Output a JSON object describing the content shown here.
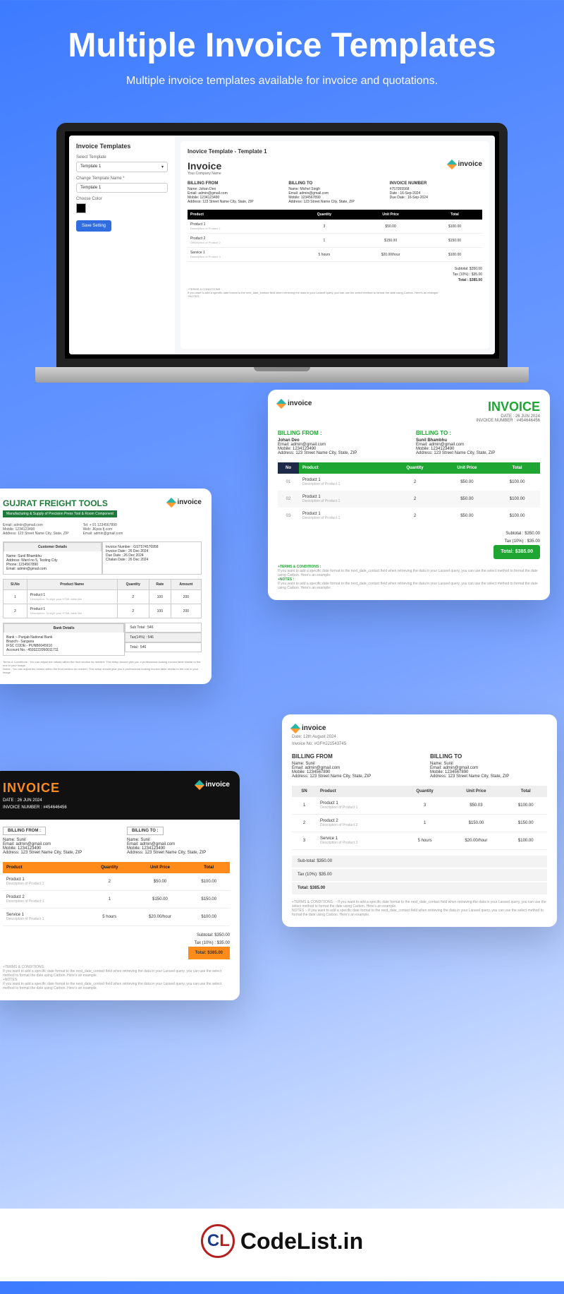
{
  "hero": {
    "title": "Multiple Invoice Templates",
    "subtitle": "Multiple invoice templates available for invoice and quotations."
  },
  "laptop": {
    "sidebar": {
      "title": "Invoice Templates",
      "select_label": "Select Template",
      "select_value": "Template 1",
      "name_label": "Change Template Name *",
      "name_value": "Template 1",
      "color_label": "Choose Color",
      "save": "Save Setting"
    },
    "preview": {
      "section_title": "Inovice Template - Template 1",
      "invoice_title": "Invoice",
      "company": "Your Company Name",
      "brand": "invoice",
      "from_h": "BILLING FROM",
      "from_lines": "Name: Johan Deo\nEmail: admin@gmail.com\nMobile: 1234123490\nAddress: 123 Street Name City, State, ZIP",
      "to_h": "BILLING TO",
      "to_lines": "Name: Michel Singh\nEmail: admin@gmail.com\nMobile: 1234567890\nAddress: 123 Street Name City, State, ZIP",
      "num_h": "INVOICE NUMBER",
      "num_lines": "#757055568\nDate : 16-Sep-2024\nDue Date : 16-Sep-2024",
      "th": {
        "p": "Product",
        "q": "Quantity",
        "u": "Unit Price",
        "t": "Total"
      },
      "rows": [
        {
          "p": "Product 1",
          "d": "Description of Product 1",
          "q": "3",
          "u": "$50.00",
          "t": "$100.00"
        },
        {
          "p": "Product 2",
          "d": "Description of Product 2",
          "q": "1",
          "u": "$150.00",
          "t": "$150.00"
        },
        {
          "p": "Service 1",
          "d": "Description of Product 3",
          "q": "5 hours",
          "u": "$20.00/hour",
          "t": "$100.00"
        }
      ],
      "subtotal": "Subtotal:  $350.00",
      "tax": "Tax (10%) :  $35.00",
      "total": "Total :  $385.00",
      "terms": "+TERMS & CONDITIONS :\nIf you want to add a specific date format to the next_date_contact field when retrieving the data in your Laravel query, you can use the select method to format the date using Carbon. Here's an example:\n+NOTES :"
    }
  },
  "card2": {
    "brand": "invoice",
    "title": "INVOICE",
    "date": "DATE : 26 JUN 2024",
    "number": "INVOICE NUMBER : #454646456",
    "from_h": "BILLING FROM :",
    "from_name": "Johan Deo",
    "to_h": "BILLING TO :",
    "to_name": "Sunil Bhambhu",
    "contact": "Email: admin@gmail.com\nMobile: 1234123490\nAddress: 123 Street Name City, State, ZIP",
    "th": {
      "n": "No",
      "p": "Product",
      "q": "Quantity",
      "u": "Unit Price",
      "t": "Total"
    },
    "rows": [
      {
        "n": "01",
        "p": "Product 1",
        "d": "Description of Product 1",
        "q": "2",
        "u": "$50.00",
        "t": "$100.00"
      },
      {
        "n": "02",
        "p": "Product 1",
        "d": "Description of Product 1",
        "q": "2",
        "u": "$50.00",
        "t": "$100.00"
      },
      {
        "n": "03",
        "p": "Product 1",
        "d": "Description of Product 1",
        "q": "2",
        "u": "$50.00",
        "t": "$100.00"
      }
    ],
    "subtotal": "Subtotal :  $350.00",
    "tax": "Tax (10%) :  $35.00",
    "total": "Total:  $385.00",
    "terms_h": "+TERMS & CONDITIONS :",
    "terms_body": "If you want to add a specific date format to the next_date_contact field when retrieving the data in your Laravel query, you can use the select method to format the date using Carbon. Here's an example:",
    "notes_h": "+NOTES :",
    "notes_body": "If you want to add a specific date format to the next_date_contact field when retrieving the data in your Laravel query, you can use the select method to format the date using Carbon. Here's an example:"
  },
  "card3": {
    "brand": "invoice",
    "name": "GUJRAT FREIGHT TOOLS",
    "bar": "Manufacturing & Supply of Precision Press Tool & Room Component",
    "left_info": "Email: admin@gmail.com\nMobile: 1234123490\nAddress: 123 Street Name City, State, ZIP",
    "right_info": "Tel: + 91 1234567890\nWeb: JKpos.fj.com\nEmail: admin@gmail.com",
    "cust_h": "Customer Details",
    "cust": "Name: Sunil Bhambhu\nAddress: Ward no 5, Testing City\nPhone: 1234567890\nEmail: admin@gmail.com",
    "inv_info": "Invoice Number : GST574576958\nInvoice Date : 26 Dec 2024\nDue Date : 26 Dec 2024\nChalan Date : 26 Dec 2024",
    "th": {
      "s": "Sl.No",
      "p": "Product Name",
      "q": "Quantity",
      "r": "Rate",
      "a": "Amount"
    },
    "rows": [
      {
        "s": "1",
        "p": "Product 1",
        "d": "Description: To style your HTML table like",
        "q": "2",
        "r": "100",
        "a": "200"
      },
      {
        "s": "2",
        "p": "Product 1",
        "d": "Description: To style your HTML table like",
        "q": "2",
        "r": "100",
        "a": "200"
      }
    ],
    "bank_h": "Bank Details",
    "bank": "Bank :- Punjab National Bank\nBranch:- Sargana\nIFSC CODE:- PUNB0045910\nAccount No.- 4593222050011711",
    "sub": "Sub Total : 546",
    "taxl": "Tax(14%) : 546",
    "tot": "Total : 546",
    "fp": "Terms & Conditions : You can adjust the values within the tfoot section as needed. This setup should give you a professional-looking invoice table similar to the one in your image.\nNotes : You can adjust the values within the tfoot section as needed. This setup should give you a professional-looking invoice table similar to the one in your image."
  },
  "card4": {
    "brand": "invoice",
    "title": "INVOICE",
    "date": "DATE : 26 JUN 2024",
    "number": "INVOICE NUMBER : #454646456",
    "from_h": "BILLING FROM :",
    "to_h": "BILLING TO :",
    "contact": "Name: Sunil\nEmail: admin@gmail.com\nMobile: 1234123490\nAddress: 123 Street Name City, State, ZIP",
    "th": {
      "p": "Product",
      "q": "Quantity",
      "u": "Unit Price",
      "t": "Total"
    },
    "rows": [
      {
        "p": "Product 1",
        "d": "Description of Product 1",
        "q": "2",
        "u": "$50.00",
        "t": "$100.00"
      },
      {
        "p": "Product 2",
        "d": "Description of Product 1",
        "q": "1",
        "u": "$150.00",
        "t": "$150.00"
      },
      {
        "p": "Service 1",
        "d": "Description of Product 1",
        "q": "5 hours",
        "u": "$20.00/hour",
        "t": "$100.00"
      }
    ],
    "subtotal": "Subtotal:  $350.00",
    "tax": "Tax (10%) :  $35.00",
    "total": "Total:  $385.00",
    "terms": "+TERMS & CONDITIONS:\nIf you want to add a specific date format to the next_date_contact field when retrieving the data in your Laravel query, you can use the select method to format the date using Carbon. Here's an example.\n+NOTES:\nIf you want to add a specific date format to the next_date_contact field when retrieving the data in your Laravel query, you can use the select method to format the date using Carbon. Here's an example."
  },
  "card5": {
    "brand": "invoice",
    "date": "Date: 12th August 2024",
    "number": "Invoice No: #GFHJJ1543745",
    "from_h": "BILLING FROM",
    "to_h": "BILLING TO",
    "contact": "Name: Sunil\nEmail: admin@gmail.com\nMobile: 1234567890\nAddress: 123 Street Name City, State, ZIP",
    "th": {
      "s": "SN",
      "p": "Product",
      "q": "Quantity",
      "u": "Unit Price",
      "t": "Total"
    },
    "rows": [
      {
        "s": "1",
        "p": "Product 1",
        "d": "Description of Product 1",
        "q": "3",
        "u": "$50.03",
        "t": "$100.00"
      },
      {
        "s": "2",
        "p": "Product 2",
        "d": "Description of Product 2",
        "q": "1",
        "u": "$150.00",
        "t": "$150.00"
      },
      {
        "s": "3",
        "p": "Service 1",
        "d": "Description of Product 3",
        "q": "5 hours",
        "u": "$20.00/hour",
        "t": "$100.00"
      }
    ],
    "subtotal": "Sub-total:  $350.00",
    "tax": "Tax (10%):  $35.00",
    "total": "Total:  $385.00",
    "terms": "+TERMS & CONDITIONS : - If you want to add a specific date format to the next_date_contact field when retrieving the data in your Laravel query, you can use the select method to format the date using Carbon. Here's an example.\nNOTES :- If you want to add a specific date format to the next_date_contact field when retrieving the data in your Laravel query, you can use the select method to format the date using Carbon. Here's an example."
  },
  "footer": {
    "brand": "CodeList.in"
  }
}
